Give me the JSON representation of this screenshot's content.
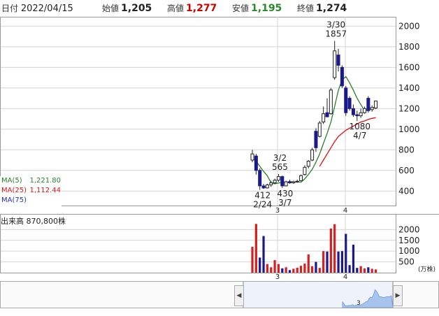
{
  "header": {
    "date_label": "日付",
    "date_value": "2022/04/15",
    "open_label": "始値",
    "open_value": "1,205",
    "high_label": "高値",
    "high_value": "1,277",
    "low_label": "安値",
    "low_value": "1,195",
    "close_label": "終値",
    "close_value": "1,274"
  },
  "colors": {
    "up": "#ffffff",
    "down": "#1a1a8c",
    "wick": "#222222",
    "ma5": "#2d7d2d",
    "ma25": "#dd1111",
    "ma75": "#2233aa",
    "high_value": "#cc0000",
    "low_value": "#2a8a2a",
    "vol_up": "#d42020",
    "vol_down": "#1a1a8c",
    "grid": "#d4d4d4"
  },
  "legend": [
    {
      "name": "MA(5)",
      "value": "1,221.80",
      "color": "#2d7d2d"
    },
    {
      "name": "MA(25)",
      "value": "1,112.44",
      "color": "#dd1111"
    },
    {
      "name": "MA(75)",
      "value": "",
      "color": "#2233aa"
    }
  ],
  "volume_label": "出来高",
  "volume_value": "870,800株",
  "volume_unit": "(万株)",
  "chart_data": [
    {
      "type": "candlestick",
      "title": "",
      "x_ticks": [
        "3",
        "4"
      ],
      "y_ticks": [
        400,
        600,
        800,
        1000,
        1200,
        1400,
        1600,
        1800,
        2000
      ],
      "ylim": [
        300,
        2050
      ],
      "grid": true,
      "candles": [
        {
          "o": 700,
          "h": 800,
          "l": 680,
          "c": 760
        },
        {
          "o": 740,
          "h": 760,
          "l": 560,
          "c": 600
        },
        {
          "o": 600,
          "h": 620,
          "l": 412,
          "c": 450
        },
        {
          "o": 450,
          "h": 470,
          "l": 420,
          "c": 430
        },
        {
          "o": 430,
          "h": 470,
          "l": 425,
          "c": 460
        },
        {
          "o": 460,
          "h": 500,
          "l": 440,
          "c": 480
        },
        {
          "o": 480,
          "h": 520,
          "l": 470,
          "c": 505
        },
        {
          "o": 505,
          "h": 565,
          "l": 490,
          "c": 540
        },
        {
          "o": 540,
          "h": 550,
          "l": 430,
          "c": 450
        },
        {
          "o": 450,
          "h": 500,
          "l": 445,
          "c": 490
        },
        {
          "o": 490,
          "h": 510,
          "l": 470,
          "c": 480
        },
        {
          "o": 480,
          "h": 500,
          "l": 470,
          "c": 490
        },
        {
          "o": 490,
          "h": 510,
          "l": 480,
          "c": 495
        },
        {
          "o": 500,
          "h": 560,
          "l": 495,
          "c": 550
        },
        {
          "o": 560,
          "h": 650,
          "l": 550,
          "c": 630
        },
        {
          "o": 640,
          "h": 700,
          "l": 620,
          "c": 690
        },
        {
          "o": 700,
          "h": 820,
          "l": 690,
          "c": 800
        },
        {
          "o": 980,
          "h": 1010,
          "l": 780,
          "c": 820
        },
        {
          "o": 930,
          "h": 1080,
          "l": 920,
          "c": 1060
        },
        {
          "o": 1070,
          "h": 1220,
          "l": 1050,
          "c": 1150
        },
        {
          "o": 1160,
          "h": 1300,
          "l": 1140,
          "c": 1120
        },
        {
          "o": 1150,
          "h": 1400,
          "l": 1140,
          "c": 1380
        },
        {
          "o": 1500,
          "h": 1857,
          "l": 1480,
          "c": 1760
        },
        {
          "o": 1720,
          "h": 1780,
          "l": 1560,
          "c": 1620
        },
        {
          "o": 1600,
          "h": 1620,
          "l": 1400,
          "c": 1420
        },
        {
          "o": 1400,
          "h": 1420,
          "l": 1130,
          "c": 1160
        },
        {
          "o": 1300,
          "h": 1320,
          "l": 1180,
          "c": 1200
        },
        {
          "o": 1200,
          "h": 1240,
          "l": 1120,
          "c": 1140
        },
        {
          "o": 1140,
          "h": 1180,
          "l": 1080,
          "c": 1130
        },
        {
          "o": 1130,
          "h": 1200,
          "l": 1110,
          "c": 1160
        },
        {
          "o": 1160,
          "h": 1220,
          "l": 1150,
          "c": 1200
        },
        {
          "o": 1300,
          "h": 1320,
          "l": 1160,
          "c": 1180
        },
        {
          "o": 1190,
          "h": 1230,
          "l": 1170,
          "c": 1210
        },
        {
          "o": 1205,
          "h": 1277,
          "l": 1195,
          "c": 1274
        }
      ],
      "ma5": [
        720,
        690,
        640,
        590,
        548,
        480,
        470,
        478,
        484,
        486,
        492,
        488,
        490,
        486,
        518,
        562,
        610,
        680,
        760,
        860,
        960,
        1070,
        1220,
        1380,
        1480,
        1510,
        1450,
        1380,
        1300,
        1240,
        1180,
        1190,
        1200,
        1222
      ],
      "ma25": [
        null,
        null,
        null,
        null,
        null,
        null,
        null,
        null,
        null,
        null,
        null,
        null,
        null,
        null,
        null,
        null,
        null,
        null,
        640,
        700,
        760,
        820,
        880,
        930,
        960,
        990,
        1010,
        1030,
        1050,
        1070,
        1080,
        1095,
        1105,
        1112
      ],
      "annotations": [
        {
          "candle": 2,
          "lines": [
            "412",
            "2/24"
          ],
          "anchor": "low"
        },
        {
          "candle": 7,
          "lines": [
            "3/2",
            "565"
          ],
          "anchor": "high"
        },
        {
          "candle": 8,
          "lines": [
            "430",
            "3/7"
          ],
          "anchor": "low"
        },
        {
          "candle": 22,
          "lines": [
            "3/30",
            "1857"
          ],
          "anchor": "high"
        },
        {
          "candle": 28,
          "lines": [
            "1080",
            "4/7"
          ],
          "anchor": "low"
        }
      ]
    },
    {
      "type": "bar",
      "title": "出来高",
      "x_ticks": [
        "3",
        "4"
      ],
      "y_ticks": [
        500,
        1000,
        1500,
        2000
      ],
      "ylim": [
        0,
        2400
      ],
      "volumes": [
        1200,
        2260,
        700,
        1700,
        400,
        250,
        580,
        400,
        200,
        250,
        120,
        180,
        230,
        320,
        420,
        850,
        300,
        500,
        220,
        1000,
        980,
        2050,
        2250,
        980,
        1000,
        1800,
        350,
        1300,
        220,
        300,
        200,
        250,
        180,
        150
      ],
      "up": [
        true,
        true,
        false,
        false,
        true,
        true,
        true,
        true,
        false,
        true,
        false,
        true,
        true,
        true,
        true,
        true,
        true,
        false,
        true,
        true,
        false,
        true,
        true,
        false,
        false,
        false,
        false,
        false,
        false,
        true,
        true,
        false,
        true,
        true
      ]
    }
  ]
}
